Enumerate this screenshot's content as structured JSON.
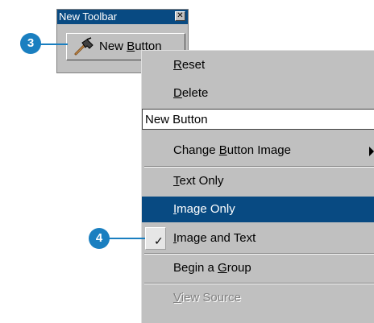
{
  "toolbar": {
    "title": "New Toolbar",
    "close_glyph": "✕",
    "button_label_pre": "New ",
    "button_label_ul": "B",
    "button_label_post": "utton"
  },
  "callouts": [
    {
      "number": "3"
    },
    {
      "number": "4"
    }
  ],
  "menu": {
    "reset": {
      "ul": "R",
      "rest": "eset"
    },
    "delete": {
      "ul": "D",
      "rest": "elete"
    },
    "name_value": "New Button",
    "change_image": {
      "pre": "Change ",
      "ul": "B",
      "rest": "utton Image"
    },
    "text_only": {
      "ul": "T",
      "rest": "ext Only"
    },
    "image_only": {
      "ul": "I",
      "rest": "mage Only"
    },
    "image_and_text": {
      "ul": "I",
      "rest": "mage and Text",
      "checked_glyph": "✓"
    },
    "begin_group": {
      "pre": "Begin a ",
      "ul": "G",
      "rest": "roup"
    },
    "view_source": {
      "ul": "V",
      "rest": "iew Source"
    }
  },
  "colors": {
    "title_bar": "#084a82",
    "highlight": "#084a82",
    "callout": "#1a7fc0",
    "menu_bg": "#c0c0c0"
  },
  "icons": {
    "tool_button": "hammer-icon",
    "submenu": "submenu-arrow-icon",
    "checked": "checkmark-icon",
    "close": "close-icon"
  }
}
